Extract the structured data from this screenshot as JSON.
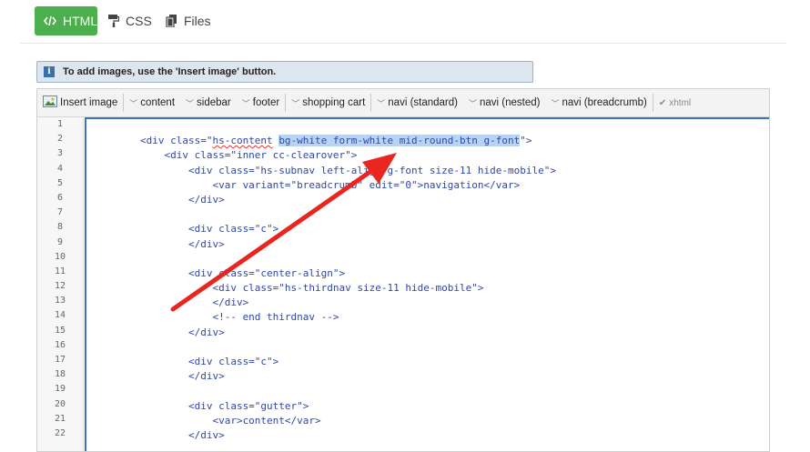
{
  "tabs": [
    {
      "label": "HTML",
      "icon": "code-icon",
      "active": true
    },
    {
      "label": "CSS",
      "icon": "paint-roller-icon",
      "active": false
    },
    {
      "label": "Files",
      "icon": "files-icon",
      "active": false
    }
  ],
  "info": {
    "icon": "info-icon",
    "text": "To add images, use the 'Insert image' button."
  },
  "toolbar": {
    "insert_image": "Insert image",
    "items": [
      "content",
      "sidebar",
      "footer",
      "shopping cart",
      "navi (standard)",
      "navi (nested)",
      "navi (breadcrumb)"
    ],
    "xhtml": "xhtml"
  },
  "line_numbers": [
    "1",
    "2",
    "3",
    "4",
    "5",
    "6",
    "7",
    "8",
    "9",
    "10",
    "11",
    "12",
    "13",
    "14",
    "15",
    "16",
    "17",
    "18",
    "19",
    "20",
    "21",
    "22"
  ],
  "code": {
    "l1": "",
    "l2a": "        <div class=\"",
    "l2b": "hs-content",
    "l2c": " ",
    "l2d": "bg-white form-white mid-round-btn g-font",
    "l2e": "\">",
    "l3": "            <div class=\"inner cc-clearover\">",
    "l4": "                <div class=\"hs-subnav left-align g-font size-11 hide-mobile\">",
    "l5": "                    <var variant=\"breadcrumb\" edit=\"0\">navigation</var>",
    "l6": "                </div>",
    "l7": "",
    "l8": "                <div class=\"c\">",
    "l9": "                </div>",
    "l10": "",
    "l11": "                <div class=\"center-align\">",
    "l12": "                    <div class=\"hs-thirdnav size-11 hide-mobile\">",
    "l13": "                    </div>",
    "l14": "                    <!-- end thirdnav -->",
    "l15": "                </div>",
    "l16": "",
    "l17": "                <div class=\"c\">",
    "l18": "                </div>",
    "l19": "",
    "l20": "                <div class=\"gutter\">",
    "l21": "                    <var>content</var>",
    "l22": "                </div>"
  },
  "colors": {
    "accent_tab": "#4cae4c",
    "arrow": "#e8261f",
    "selection": "#b8d4f5"
  }
}
